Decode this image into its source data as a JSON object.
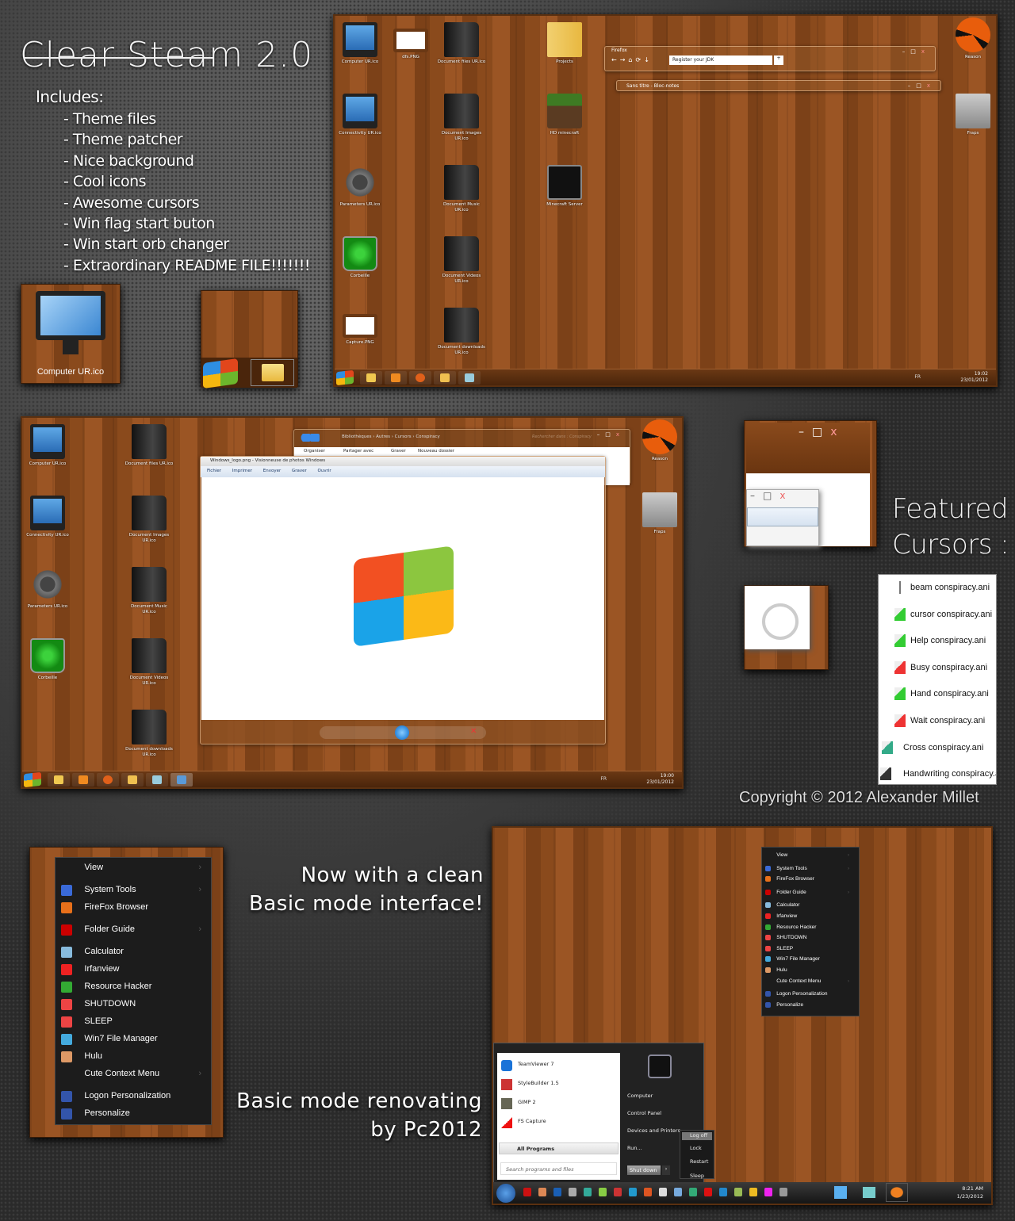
{
  "promo": {
    "title": "Clear Steam 2.0",
    "includes_label": "Includes:",
    "includes": [
      "- Theme files",
      "- Theme patcher",
      "- Nice background",
      "- Cool icons",
      "- Awesome cursors",
      "- Win flag start buton",
      "- Win start orb changer",
      "- Extraordinary README FILE!!!!!!!"
    ],
    "computer_tile_label": "Computer UR.ico",
    "featured_cursors": [
      "Featured",
      "Cursors :"
    ],
    "copyright": "Copyright © 2012 Alexander Millet",
    "basic_mode_1": [
      "Now with a clean",
      "Basic mode interface!"
    ],
    "basic_mode_2": [
      "Basic mode renovating",
      "by Pc2012"
    ]
  },
  "desktop1": {
    "icons": [
      "Computer UR.ico",
      "Connectivity UR.ico",
      "Parameters UR.ico",
      "Corbeille",
      "Capture.PNG",
      "dfs.PNG",
      "Document files  UR.ico",
      "Document Images UR.ico",
      "Document Music UR.ico",
      "Document Videos UR.ico",
      "Document downloads UR.ico",
      "Projects",
      "HD minecraft",
      "Minecraft Server",
      "Reason",
      "Fraps"
    ],
    "firefox": {
      "menu": "Firefox",
      "tab": "Register your JDK"
    },
    "notepad_title": "Sans titre - Bloc-notes",
    "tray": {
      "lang": "FR",
      "time": "19:02",
      "date": "23/01/2012"
    }
  },
  "desktop2": {
    "icons": [
      "Computer UR.ico",
      "Connectivity UR.ico",
      "Parameters UR.ico",
      "Corbeille",
      "Document files  UR.ico",
      "Document Images UR.ico",
      "Document Music UR.ico",
      "Document Videos UR.ico",
      "Document downloads UR.ico",
      "Reason",
      "Fraps"
    ],
    "explorer": {
      "breadcrumb": [
        "Bibliothèques",
        "Autres",
        "Cursors",
        "Conspiracy"
      ],
      "search_placeholder": "Rechercher dans : Conspiracy",
      "toolbar": [
        "Organiser",
        "Partager avec",
        "Graver",
        "Nouveau dossier"
      ]
    },
    "viewer": {
      "title": "Windows_logo.png - Visionneuse de photos Windows",
      "menu": [
        "Fichier",
        "Imprimer",
        "Envoyer",
        "Graver",
        "Ouvrir"
      ]
    },
    "tray": {
      "lang": "FR",
      "time": "19:00",
      "date": "23/01/2012"
    }
  },
  "cursors": [
    "beam conspiracy.ani",
    "cursor conspiracy.ani",
    "Help conspiracy.ani",
    "Busy conspiracy.ani",
    "Hand conspiracy.ani",
    "Wait conspiracy.ani",
    "Cross conspiracy.ani",
    "Handwriting conspiracy.ani"
  ],
  "context_menu": {
    "items": [
      {
        "label": "View",
        "icon": "none",
        "sub": true
      },
      {
        "label": "System Tools",
        "icon": "system-tools",
        "sub": true
      },
      {
        "label": "FireFox Browser",
        "icon": "firefox",
        "sub": false
      },
      {
        "label": "Folder Guide",
        "icon": "folder-guide",
        "sub": true
      },
      {
        "label": "Calculator",
        "icon": "calculator",
        "sub": false
      },
      {
        "label": "Irfanview",
        "icon": "irfanview",
        "sub": false
      },
      {
        "label": "Resource Hacker",
        "icon": "resource-hacker",
        "sub": false
      },
      {
        "label": "SHUTDOWN",
        "icon": "power",
        "sub": false
      },
      {
        "label": "SLEEP",
        "icon": "power",
        "sub": false
      },
      {
        "label": "Win7 File Manager",
        "icon": "file-manager",
        "sub": false
      },
      {
        "label": "Hulu",
        "icon": "hulu",
        "sub": false
      },
      {
        "label": "Cute Context Menu",
        "icon": "none",
        "sub": true
      },
      {
        "label": "Logon Personalization",
        "icon": "personalize",
        "sub": false
      },
      {
        "label": "Personalize",
        "icon": "personalize",
        "sub": false
      }
    ]
  },
  "start_menu": {
    "programs": [
      "TeamViewer 7",
      "StyleBuilder 1.5",
      "GIMP 2",
      "FS Capture"
    ],
    "all_programs": "All Programs",
    "search_placeholder": "Search programs and files",
    "right": [
      "Computer",
      "Control Panel",
      "Devices and Printers",
      "Run..."
    ],
    "shutdown": "Shut down",
    "power_options": [
      "Log off",
      "Lock",
      "Restart",
      "Sleep"
    ],
    "tray": {
      "time": "8:21 AM",
      "date": "1/23/2012"
    }
  },
  "colors": {
    "wood": "#8a4a1c",
    "background": "#2b2b2b",
    "menu": "#1c1c1c"
  }
}
